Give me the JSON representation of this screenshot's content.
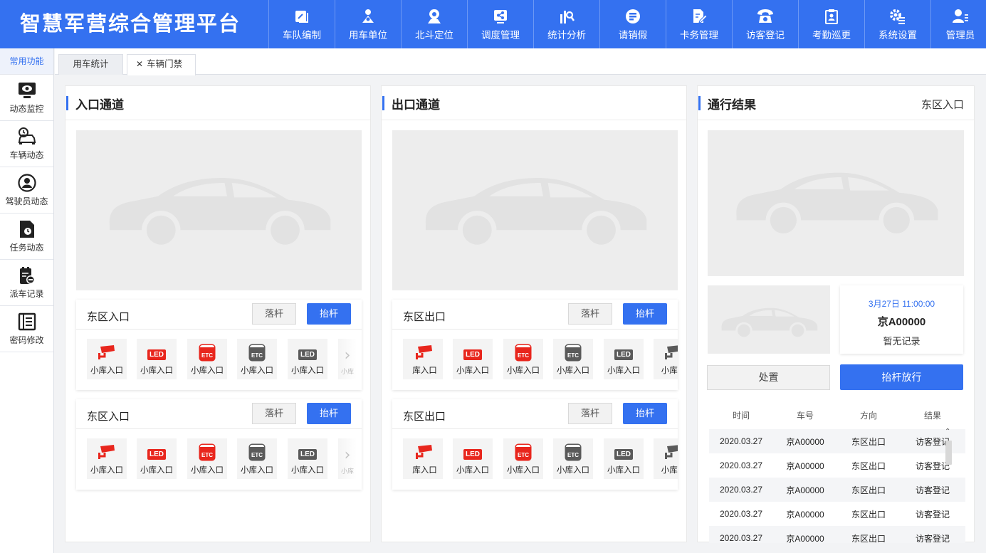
{
  "app_title": "智慧军营综合管理平台",
  "nav": [
    {
      "label": "车队编制",
      "icon": "fleet-icon"
    },
    {
      "label": "用车单位",
      "icon": "unit-icon"
    },
    {
      "label": "北斗定位",
      "icon": "location-pin-icon"
    },
    {
      "label": "调度管理",
      "icon": "share-icon"
    },
    {
      "label": "统计分析",
      "icon": "stats-icon"
    },
    {
      "label": "请销假",
      "icon": "leave-icon"
    },
    {
      "label": "卡务管理",
      "icon": "card-edit-icon"
    },
    {
      "label": "访客登记",
      "icon": "phone-icon"
    },
    {
      "label": "考勤巡更",
      "icon": "clipboard-icon"
    },
    {
      "label": "系统设置",
      "icon": "settings-icon"
    },
    {
      "label": "管理员",
      "icon": "user-icon"
    }
  ],
  "sidebar": {
    "header": "常用功能",
    "items": [
      {
        "label": "动态监控",
        "icon": "monitor-icon"
      },
      {
        "label": "车辆动态",
        "icon": "car-clock-icon"
      },
      {
        "label": "驾驶员动态",
        "icon": "driver-icon"
      },
      {
        "label": "任务动态",
        "icon": "task-icon"
      },
      {
        "label": "派车记录",
        "icon": "dispatch-icon"
      },
      {
        "label": "密码修改",
        "icon": "list-icon"
      }
    ]
  },
  "tabs": [
    {
      "label": "用车统计",
      "close": ""
    },
    {
      "label": "车辆门禁",
      "close": "✕"
    }
  ],
  "entry": {
    "title": "入口通道",
    "gates": [
      {
        "name": "东区入口",
        "drop": "落杆",
        "lift": "抬杆"
      },
      {
        "name": "东区入口",
        "drop": "落杆",
        "lift": "抬杆"
      }
    ],
    "devices": [
      {
        "type": "camera-icon",
        "label": "小库入口"
      },
      {
        "type": "led-red-icon",
        "label": "小库入口",
        "text": "LED"
      },
      {
        "type": "etc-red-icon",
        "label": "小库入口",
        "text": "ETC"
      },
      {
        "type": "etc-gray-icon",
        "label": "小库入口",
        "text": "ETC"
      },
      {
        "type": "led-gray-icon",
        "label": "小库入口",
        "text": "LED"
      }
    ],
    "more_label": "小库"
  },
  "exit": {
    "title": "出口通道",
    "gates": [
      {
        "name": "东区出口",
        "drop": "落杆",
        "lift": "抬杆"
      },
      {
        "name": "东区出口",
        "drop": "落杆",
        "lift": "抬杆"
      }
    ],
    "devices": [
      {
        "type": "camera-icon",
        "label": "库入口"
      },
      {
        "type": "led-red-icon",
        "label": "小库入口",
        "text": "LED"
      },
      {
        "type": "etc-red-icon",
        "label": "小库入口",
        "text": "ETC"
      },
      {
        "type": "etc-gray-icon",
        "label": "小库入口",
        "text": "ETC"
      },
      {
        "type": "led-gray-icon",
        "label": "小库入口",
        "text": "LED"
      },
      {
        "type": "camera-gray-icon",
        "label": "小库入"
      }
    ]
  },
  "result": {
    "title": "通行结果",
    "location": "东区入口",
    "time": "3月27日 11:00:00",
    "plate": "京A00000",
    "status": "暂无记录",
    "handle": "处置",
    "release": "抬杆放行",
    "columns": [
      "时间",
      "车号",
      "方向",
      "结果"
    ],
    "rows": [
      [
        "2020.03.27",
        "京A00000",
        "东区出口",
        "访客登记"
      ],
      [
        "2020.03.27",
        "京A00000",
        "东区出口",
        "访客登记"
      ],
      [
        "2020.03.27",
        "京A00000",
        "东区出口",
        "访客登记"
      ],
      [
        "2020.03.27",
        "京A00000",
        "东区出口",
        "访客登记"
      ],
      [
        "2020.03.27",
        "京A00000",
        "东区出口",
        "访客登记"
      ]
    ]
  },
  "colors": {
    "primary": "#3471f0",
    "led_red": "#e8261d",
    "device_gray": "#5a5a5a"
  }
}
